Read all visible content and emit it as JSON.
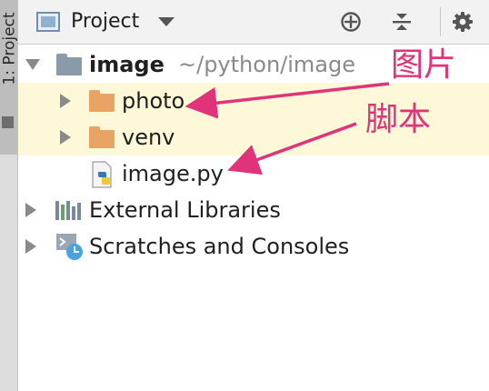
{
  "sidebar": {
    "tab_label": "1: Project"
  },
  "header": {
    "title": "Project",
    "icons": [
      "crosshair-icon",
      "collapse-icon",
      "gear-icon"
    ]
  },
  "tree": {
    "root": {
      "name": "image",
      "path": "~/python/image"
    },
    "items": [
      {
        "name": "photo",
        "type": "folder"
      },
      {
        "name": "venv",
        "type": "folder"
      },
      {
        "name": "image.py",
        "type": "python-file"
      }
    ],
    "external": "External Libraries",
    "scratches": "Scratches and Consoles"
  },
  "annotations": {
    "photo_note": "图片",
    "script_note": "脚本"
  },
  "colors": {
    "highlight": "#fdf8d8",
    "folder": "#e8a365",
    "root_folder": "#8a9aab",
    "annotation": "#e0337a"
  }
}
